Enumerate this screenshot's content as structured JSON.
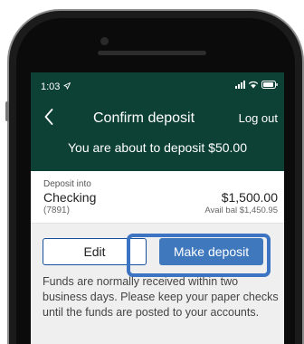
{
  "status_bar": {
    "time": "1:03"
  },
  "nav": {
    "title": "Confirm deposit",
    "logout": "Log out"
  },
  "subtitle": "You are about to deposit $50.00",
  "account": {
    "deposit_into_label": "Deposit into",
    "name": "Checking",
    "number": "(7891)",
    "balance": "$1,500.00",
    "available": "Avail bal $1,450.95"
  },
  "actions": {
    "edit": "Edit",
    "make_deposit": "Make deposit"
  },
  "info_text": "Funds are normally received within two business days. Please keep your paper checks until the funds are posted to your accounts.",
  "colors": {
    "header": "#0d4136",
    "primary_button": "#3f78bd",
    "highlight": "#3c74c3"
  },
  "icons": [
    "location-arrow-icon",
    "signal-icon",
    "wifi-icon",
    "battery-icon",
    "back-chevron-icon"
  ]
}
